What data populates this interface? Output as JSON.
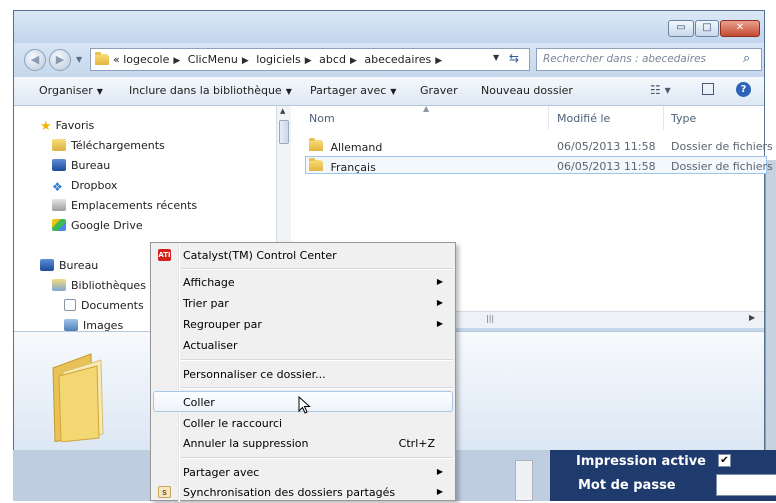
{
  "window": {
    "minimize_glyph": "▭",
    "maximize_glyph": "□",
    "close_glyph": "✕"
  },
  "address": {
    "crumbs": [
      "logecole",
      "ClicMenu",
      "logiciels",
      "abcd",
      "abecedaires"
    ],
    "overflow_glyph": "«",
    "search_placeholder": "Rechercher dans : abecedaires"
  },
  "toolbar": {
    "organize": "Organiser",
    "include_library": "Inclure dans la bibliothèque",
    "share_with": "Partager avec",
    "burn": "Graver",
    "new_folder": "Nouveau dossier"
  },
  "nav_pane": {
    "favorites": "Favoris",
    "favorites_items": [
      "Téléchargements",
      "Bureau",
      "Dropbox",
      "Emplacements récents",
      "Google Drive"
    ],
    "desktop": "Bureau",
    "libraries": "Bibliothèques",
    "library_items": [
      "Documents",
      "Images"
    ]
  },
  "file_list": {
    "columns": {
      "name": "Nom",
      "modified": "Modifié le",
      "type": "Type"
    },
    "rows": [
      {
        "name": "Allemand",
        "modified": "06/05/2013 11:58",
        "type": "Dossier de fichiers"
      },
      {
        "name": "Français",
        "modified": "06/05/2013 11:58",
        "type": "Dossier de fichiers"
      }
    ]
  },
  "context_menu": {
    "catalyst": "Catalyst(TM) Control Center",
    "catalyst_icon_text": "ATI",
    "view": "Affichage",
    "sort_by": "Trier par",
    "group_by": "Regrouper par",
    "refresh": "Actualiser",
    "customize": "Personnaliser ce dossier...",
    "paste": "Coller",
    "paste_shortcut": "Coller le raccourci",
    "undo_delete": "Annuler la suppression",
    "undo_delete_key": "Ctrl+Z",
    "share_with": "Partager avec",
    "sync_shared": "Synchronisation des dossiers partagés"
  },
  "background_app": {
    "print_active": "Impression active",
    "print_checkbox": "✔",
    "password": "Mot de passe"
  },
  "colors": {
    "window_frame": "#c5d7ec",
    "close_button": "#c44a33",
    "menu_background": "#f0f0f0",
    "background_panel": "#1f3a6d"
  }
}
